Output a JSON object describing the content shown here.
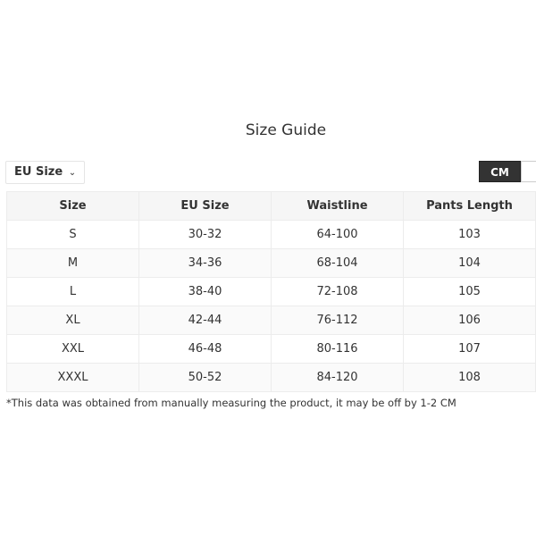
{
  "title": "Size Guide",
  "size_dropdown": {
    "label": "EU Size",
    "icon": "chevron-down-icon"
  },
  "units": {
    "active": "CM",
    "other": ""
  },
  "colors": {
    "active_unit_bg": "#333333"
  },
  "table": {
    "headers": [
      "Size",
      "EU Size",
      "Waistline",
      "Pants Length"
    ],
    "rows": [
      [
        "S",
        "30-32",
        "64-100",
        "103"
      ],
      [
        "M",
        "34-36",
        "68-104",
        "104"
      ],
      [
        "L",
        "38-40",
        "72-108",
        "105"
      ],
      [
        "XL",
        "42-44",
        "76-112",
        "106"
      ],
      [
        "XXL",
        "46-48",
        "80-116",
        "107"
      ],
      [
        "XXXL",
        "50-52",
        "84-120",
        "108"
      ]
    ]
  },
  "footnote": "*This data was obtained from manually measuring the product, it may be off by 1-2 CM"
}
